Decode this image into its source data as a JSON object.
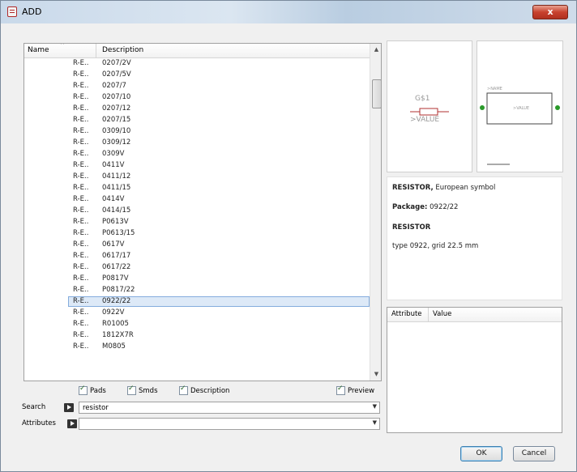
{
  "window": {
    "title": "ADD",
    "close_label": "x"
  },
  "list": {
    "columns": {
      "name": "Name",
      "description": "Description"
    },
    "rows": [
      {
        "name": "R-E..",
        "description": "0207/2V"
      },
      {
        "name": "R-E..",
        "description": "0207/5V"
      },
      {
        "name": "R-E..",
        "description": "0207/7"
      },
      {
        "name": "R-E..",
        "description": "0207/10"
      },
      {
        "name": "R-E..",
        "description": "0207/12"
      },
      {
        "name": "R-E..",
        "description": "0207/15"
      },
      {
        "name": "R-E..",
        "description": "0309/10"
      },
      {
        "name": "R-E..",
        "description": "0309/12"
      },
      {
        "name": "R-E..",
        "description": "0309V"
      },
      {
        "name": "R-E..",
        "description": "0411V"
      },
      {
        "name": "R-E..",
        "description": "0411/12"
      },
      {
        "name": "R-E..",
        "description": "0411/15"
      },
      {
        "name": "R-E..",
        "description": "0414V"
      },
      {
        "name": "R-E..",
        "description": "0414/15"
      },
      {
        "name": "R-E..",
        "description": "P0613V"
      },
      {
        "name": "R-E..",
        "description": "P0613/15"
      },
      {
        "name": "R-E..",
        "description": "0617V"
      },
      {
        "name": "R-E..",
        "description": "0617/17"
      },
      {
        "name": "R-E..",
        "description": "0617/22"
      },
      {
        "name": "R-E..",
        "description": "P0817V"
      },
      {
        "name": "R-E..",
        "description": "P0817/22"
      },
      {
        "name": "R-E..",
        "description": "0922/22",
        "selected": true
      },
      {
        "name": "R-E..",
        "description": "0922V"
      },
      {
        "name": "R-E..",
        "description": "R01005"
      },
      {
        "name": "R-E..",
        "description": "1812X7R"
      },
      {
        "name": "R-E..",
        "description": "M0805"
      }
    ]
  },
  "filters": {
    "pads": "Pads",
    "smds": "Smds",
    "description": "Description",
    "preview": "Preview"
  },
  "search": {
    "label": "Search",
    "value": "resistor"
  },
  "attributes": {
    "label": "Attributes",
    "value": ""
  },
  "symbol_preview": {
    "name_text": "G$1",
    "value_text": ">VALUE"
  },
  "package_preview": {
    "name_text": ">NAME",
    "value_text": ">VALUE"
  },
  "info": {
    "line1_bold": "RESISTOR,",
    "line1_rest": " European symbol",
    "line2_bold": "Package:",
    "line2_rest": " 0922/22",
    "line3": "RESISTOR",
    "line4": "type 0922, grid 22.5 mm"
  },
  "attr_table": {
    "col_attribute": "Attribute",
    "col_value": "Value"
  },
  "buttons": {
    "ok": "OK",
    "cancel": "Cancel"
  }
}
